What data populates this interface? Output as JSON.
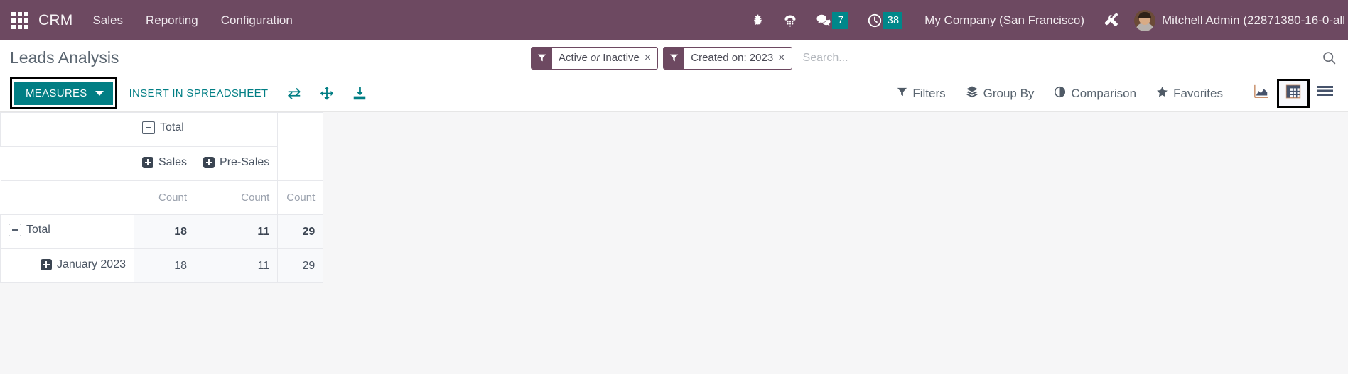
{
  "navbar": {
    "apps_icon": "apps-grid-icon",
    "brand": "CRM",
    "menu": [
      {
        "label": "Sales"
      },
      {
        "label": "Reporting"
      },
      {
        "label": "Configuration"
      }
    ],
    "icons": [
      {
        "name": "bug-icon"
      },
      {
        "name": "dialpad-icon"
      },
      {
        "name": "messages-icon",
        "badge": "7"
      },
      {
        "name": "activities-clock-icon",
        "badge": "38"
      },
      {
        "name": "tools-icon"
      }
    ],
    "messages_badge": "7",
    "activities_badge": "38",
    "company": "My Company (San Francisco)",
    "user": "Mitchell Admin (22871380-16-0-all",
    "avatar_name": "user-avatar",
    "bg_color": "#6d4961",
    "badge_color": "#00878a"
  },
  "control_panel": {
    "title": "Leads Analysis",
    "search": {
      "placeholder": "Search...",
      "value": "",
      "magnifier_icon": "search-icon",
      "facets": [
        {
          "icon": "filter-icon",
          "parts": [
            "Active",
            "or",
            "Inactive"
          ],
          "label": "Active or Inactive",
          "remove": "×"
        },
        {
          "icon": "filter-icon",
          "parts": [
            "Created on: 2023"
          ],
          "label": "Created on: 2023",
          "remove": "×"
        }
      ]
    },
    "toolbar": {
      "measures_label": "MEASURES",
      "measures_color": "#017e84",
      "insert_spreadsheet_label": "INSERT IN SPREADSHEET",
      "pivot_tools": [
        {
          "name": "flip-axis-icon"
        },
        {
          "name": "expand-all-icon"
        },
        {
          "name": "download-xlsx-icon"
        }
      ]
    },
    "dropdowns": [
      {
        "name": "filters",
        "label": "Filters",
        "icon": "filter-icon"
      },
      {
        "name": "group-by",
        "label": "Group By",
        "icon": "layers-icon"
      },
      {
        "name": "comparison",
        "label": "Comparison",
        "icon": "half-circle-icon"
      },
      {
        "name": "favorites",
        "label": "Favorites",
        "icon": "star-icon"
      }
    ],
    "views": [
      {
        "name": "graph",
        "icon": "area-chart-icon",
        "active": false
      },
      {
        "name": "pivot",
        "icon": "pivot-table-icon",
        "active": true
      },
      {
        "name": "list",
        "icon": "list-icon",
        "active": false
      }
    ]
  },
  "pivot": {
    "col_group_root": "Total",
    "col_groups": [
      {
        "label": "Sales",
        "expandable": true
      },
      {
        "label": "Pre-Sales",
        "expandable": true
      }
    ],
    "measure_headers": [
      "Count",
      "Count",
      "Count"
    ],
    "rows": [
      {
        "label": "Total",
        "level": 0,
        "state": "expanded",
        "values": [
          "18",
          "11",
          "29"
        ],
        "bold": true
      },
      {
        "label": "January 2023",
        "level": 1,
        "state": "collapsed",
        "values": [
          "18",
          "11",
          "29"
        ],
        "bold": false
      }
    ]
  }
}
